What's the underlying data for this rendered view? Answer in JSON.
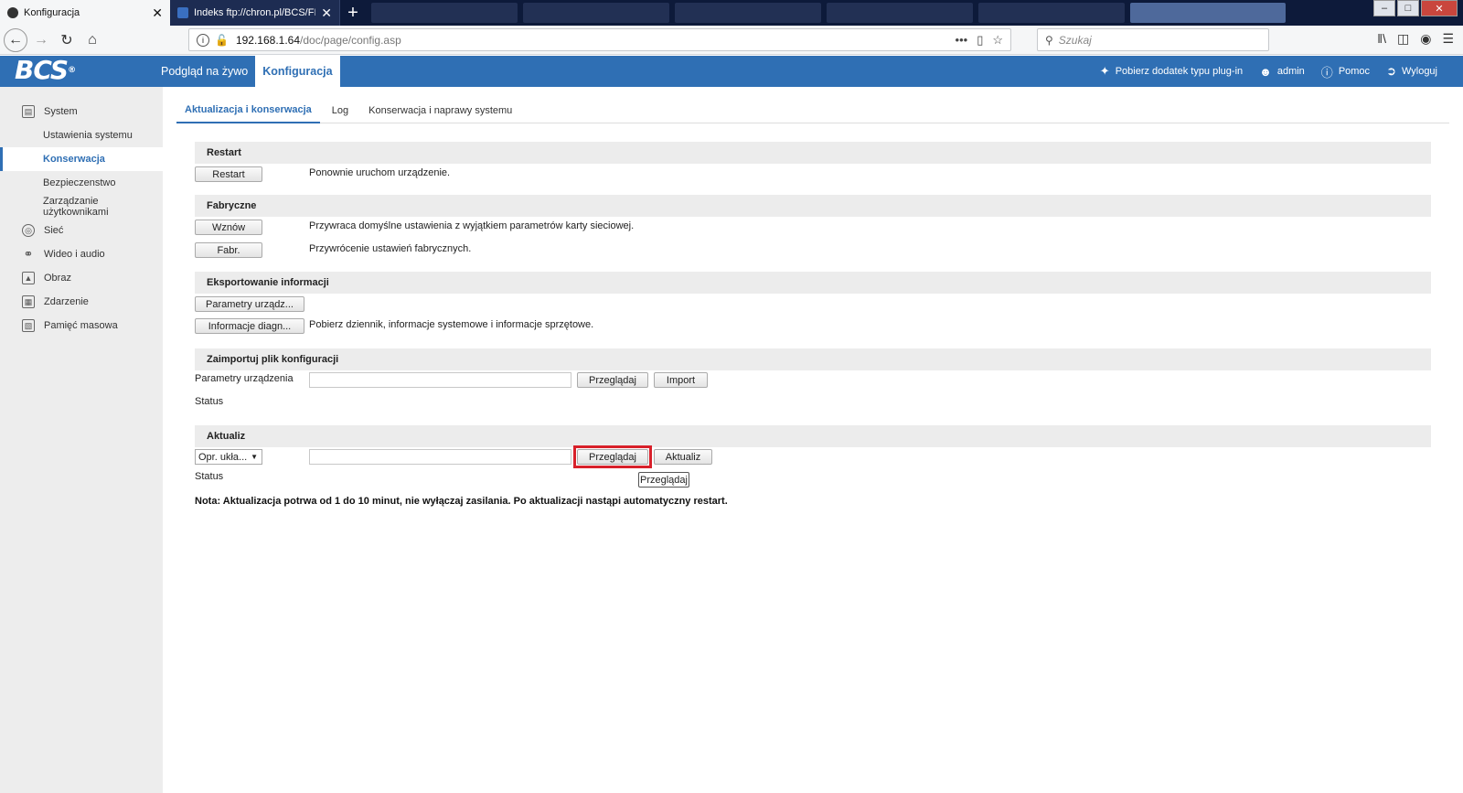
{
  "browser": {
    "tabs": [
      {
        "title": "Konfiguracja",
        "close": "✕"
      },
      {
        "title": "Indeks ftp://chron.pl/BCS/FIRM",
        "close": "✕"
      }
    ],
    "new_tab": "+",
    "url_host": "192.168.1.64",
    "url_path": "/doc/page/config.asp",
    "url_more": "•••",
    "search_placeholder": "Szukaj",
    "window_controls": {
      "minimize": "–",
      "maximize": "□",
      "close": "✕"
    }
  },
  "app": {
    "logo": "BCS",
    "logo_mark": "®",
    "topnav": [
      "Podgląd na żywo",
      "Konfiguracja"
    ],
    "header_right": {
      "plugin": "Pobierz dodatek typu plug-in",
      "user": "admin",
      "help": "Pomoc",
      "logout": "Wyloguj"
    },
    "accent_color": "#2f6fb4"
  },
  "sidebar": {
    "system": "System",
    "system_items": [
      "Ustawienia systemu",
      "Konserwacja",
      "Bezpieczenstwo",
      "Zarządzanie użytkownikami"
    ],
    "groups": [
      "Sieć",
      "Wideo i audio",
      "Obraz",
      "Zdarzenie",
      "Pamięć masowa"
    ]
  },
  "main": {
    "tabs": [
      "Aktualizacja i konserwacja",
      "Log",
      "Konserwacja i naprawy systemu"
    ],
    "restart": {
      "title": "Restart",
      "button": "Restart",
      "desc": "Ponownie uruchom urządzenie."
    },
    "factory": {
      "title": "Fabryczne",
      "restore_button": "Wznów",
      "restore_desc": "Przywraca domyślne ustawienia z wyjątkiem parametrów karty sieciowej.",
      "default_button": "Fabr.",
      "default_desc": "Przywrócenie ustawień fabrycznych."
    },
    "export": {
      "title": "Eksportowanie informacji",
      "params_button": "Parametry urządz...",
      "diag_button": "Informacje diagn...",
      "diag_desc": "Pobierz dziennik, informacje systemowe i informacje sprzętowe."
    },
    "import": {
      "title": "Zaimportuj plik konfiguracji",
      "label": "Parametry urządzenia",
      "browse_button": "Przeglądaj",
      "import_button": "Import",
      "status_label": "Status"
    },
    "upgrade": {
      "title": "Aktualiz",
      "select_value": "Opr. ukła...",
      "browse_button": "Przeglądaj",
      "upgrade_button": "Aktualiz",
      "status_label": "Status",
      "tooltip": "Przeglądaj",
      "highlight_color": "#d8202a"
    },
    "note": "Nota: Aktualizacja potrwa od 1 do 10 minut, nie wyłączaj zasilania. Po aktualizacji nastąpi automatyczny restart."
  }
}
